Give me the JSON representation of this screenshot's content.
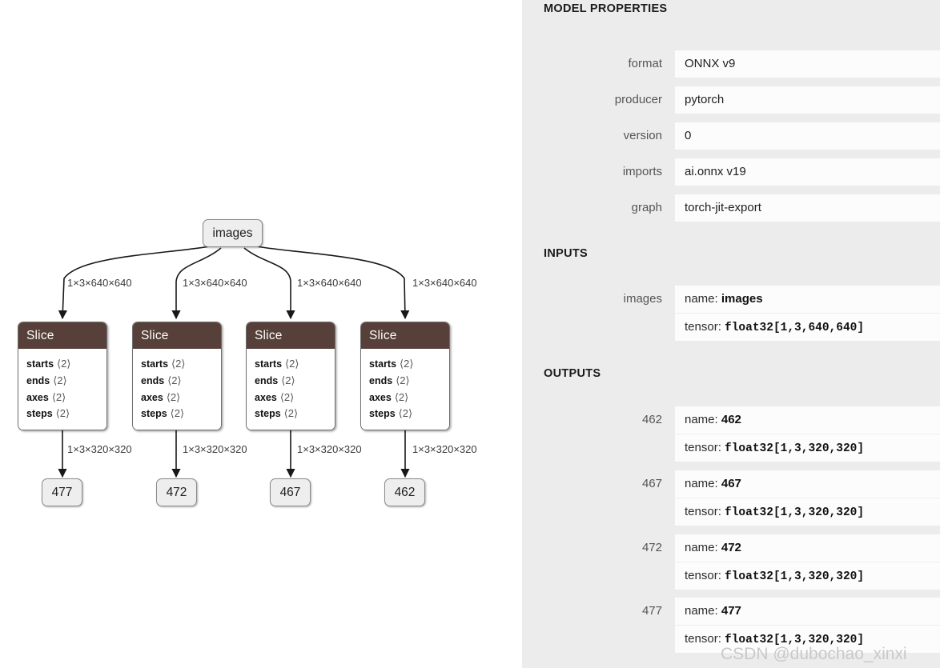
{
  "graph": {
    "input_node": {
      "label": "images"
    },
    "op_nodes": [
      {
        "title": "Slice",
        "attrs": [
          {
            "key": "starts",
            "value": "⟨2⟩"
          },
          {
            "key": "ends",
            "value": "⟨2⟩"
          },
          {
            "key": "axes",
            "value": "⟨2⟩"
          },
          {
            "key": "steps",
            "value": "⟨2⟩"
          }
        ]
      },
      {
        "title": "Slice",
        "attrs": [
          {
            "key": "starts",
            "value": "⟨2⟩"
          },
          {
            "key": "ends",
            "value": "⟨2⟩"
          },
          {
            "key": "axes",
            "value": "⟨2⟩"
          },
          {
            "key": "steps",
            "value": "⟨2⟩"
          }
        ]
      },
      {
        "title": "Slice",
        "attrs": [
          {
            "key": "starts",
            "value": "⟨2⟩"
          },
          {
            "key": "ends",
            "value": "⟨2⟩"
          },
          {
            "key": "axes",
            "value": "⟨2⟩"
          },
          {
            "key": "steps",
            "value": "⟨2⟩"
          }
        ]
      },
      {
        "title": "Slice",
        "attrs": [
          {
            "key": "starts",
            "value": "⟨2⟩"
          },
          {
            "key": "ends",
            "value": "⟨2⟩"
          },
          {
            "key": "axes",
            "value": "⟨2⟩"
          },
          {
            "key": "steps",
            "value": "⟨2⟩"
          }
        ]
      }
    ],
    "output_nodes": [
      {
        "label": "477"
      },
      {
        "label": "472"
      },
      {
        "label": "467"
      },
      {
        "label": "462"
      }
    ],
    "top_edge_labels": [
      "1×3×640×640",
      "1×3×640×640",
      "1×3×640×640",
      "1×3×640×640"
    ],
    "bottom_edge_labels": [
      "1×3×320×320",
      "1×3×320×320",
      "1×3×320×320",
      "1×3×320×320"
    ],
    "colors": {
      "op_header": "#574039",
      "node_fill": "#eeeeee",
      "edge": "#181818"
    }
  },
  "sidebar": {
    "model_properties": {
      "title": "MODEL PROPERTIES",
      "rows": [
        {
          "label": "format",
          "value": "ONNX v9"
        },
        {
          "label": "producer",
          "value": "pytorch"
        },
        {
          "label": "version",
          "value": "0"
        },
        {
          "label": "imports",
          "value": "ai.onnx v19"
        },
        {
          "label": "graph",
          "value": "torch-jit-export"
        }
      ]
    },
    "inputs": {
      "title": "INPUTS",
      "items": [
        {
          "label": "images",
          "name_prefix": "name: ",
          "name_value": "images",
          "tensor_prefix": "tensor: ",
          "tensor_value": "float32[1,3,640,640]"
        }
      ]
    },
    "outputs": {
      "title": "OUTPUTS",
      "items": [
        {
          "label": "462",
          "name_prefix": "name: ",
          "name_value": "462",
          "tensor_prefix": "tensor: ",
          "tensor_value": "float32[1,3,320,320]"
        },
        {
          "label": "467",
          "name_prefix": "name: ",
          "name_value": "467",
          "tensor_prefix": "tensor: ",
          "tensor_value": "float32[1,3,320,320]"
        },
        {
          "label": "472",
          "name_prefix": "name: ",
          "name_value": "472",
          "tensor_prefix": "tensor: ",
          "tensor_value": "float32[1,3,320,320]"
        },
        {
          "label": "477",
          "name_prefix": "name: ",
          "name_value": "477",
          "tensor_prefix": "tensor: ",
          "tensor_value": "float32[1,3,320,320]"
        }
      ]
    },
    "panel_bg": "#ececec",
    "card_bg": "#fcfcfc"
  },
  "watermark": {
    "text": "CSDN @dubochao_xinxi"
  }
}
